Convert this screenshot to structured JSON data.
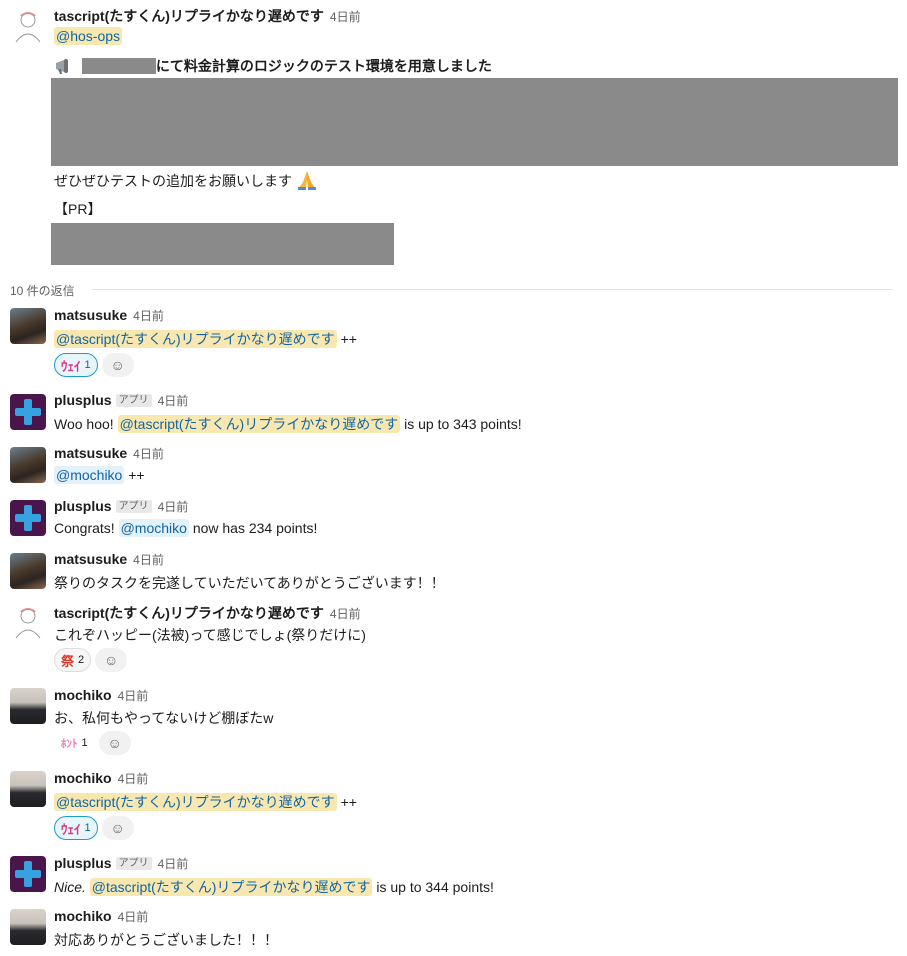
{
  "thread_root": {
    "author": "tascript(たすくん)リプライかなり遅めです",
    "time": "4日前",
    "mention": "@hos-ops",
    "heading": "にて料金計算のロジックのテスト環境を用意しました",
    "request": "ぜひぜひテストの追加をお願いします",
    "pr_label": "【PR】"
  },
  "replies_divider": "10 件の返信",
  "messages": [
    {
      "author": "matsusuke",
      "time": "4日前",
      "mention": "@tascript(たすくん)リプライかなり遅めです",
      "suffix": "++",
      "reaction": {
        "emoji": "ｳｪｲ",
        "count": "1"
      }
    },
    {
      "author": "plusplus",
      "badge": "アプリ",
      "time": "4日前",
      "prefix": "Woo hoo!",
      "mention": "@tascript(たすくん)リプライかなり遅めです",
      "suffix": "is up to 343 points!"
    },
    {
      "author": "matsusuke",
      "time": "4日前",
      "mention": "@mochiko",
      "suffix": "++"
    },
    {
      "author": "plusplus",
      "badge": "アプリ",
      "time": "4日前",
      "prefix": "Congrats!",
      "mention": "@mochiko",
      "suffix": "now has 234 points!"
    },
    {
      "author": "matsusuke",
      "time": "4日前",
      "text": "祭りのタスクを完遂していただいてありがとうございます！！"
    },
    {
      "author": "tascript(たすくん)リプライかなり遅めです",
      "time": "4日前",
      "text": "これぞハッピー(法被)って感じでしょ(祭りだけに)",
      "reaction": {
        "emoji": "祭",
        "count": "2"
      }
    },
    {
      "author": "mochiko",
      "time": "4日前",
      "text": "お、私何もやってないけど棚ぼたw",
      "reaction": {
        "emoji": "ﾎﾝﾄ",
        "count": "1"
      }
    },
    {
      "author": "mochiko",
      "time": "4日前",
      "mention": "@tascript(たすくん)リプライかなり遅めです",
      "suffix": "++",
      "reaction": {
        "emoji": "ｳｪｲ",
        "count": "1"
      }
    },
    {
      "author": "plusplus",
      "badge": "アプリ",
      "time": "4日前",
      "prefix": "Nice.",
      "mention": "@tascript(たすくん)リプライかなり遅めです",
      "suffix": "is up to 344 points!"
    },
    {
      "author": "mochiko",
      "time": "4日前",
      "text": "対応ありがとうございました！！！"
    }
  ]
}
